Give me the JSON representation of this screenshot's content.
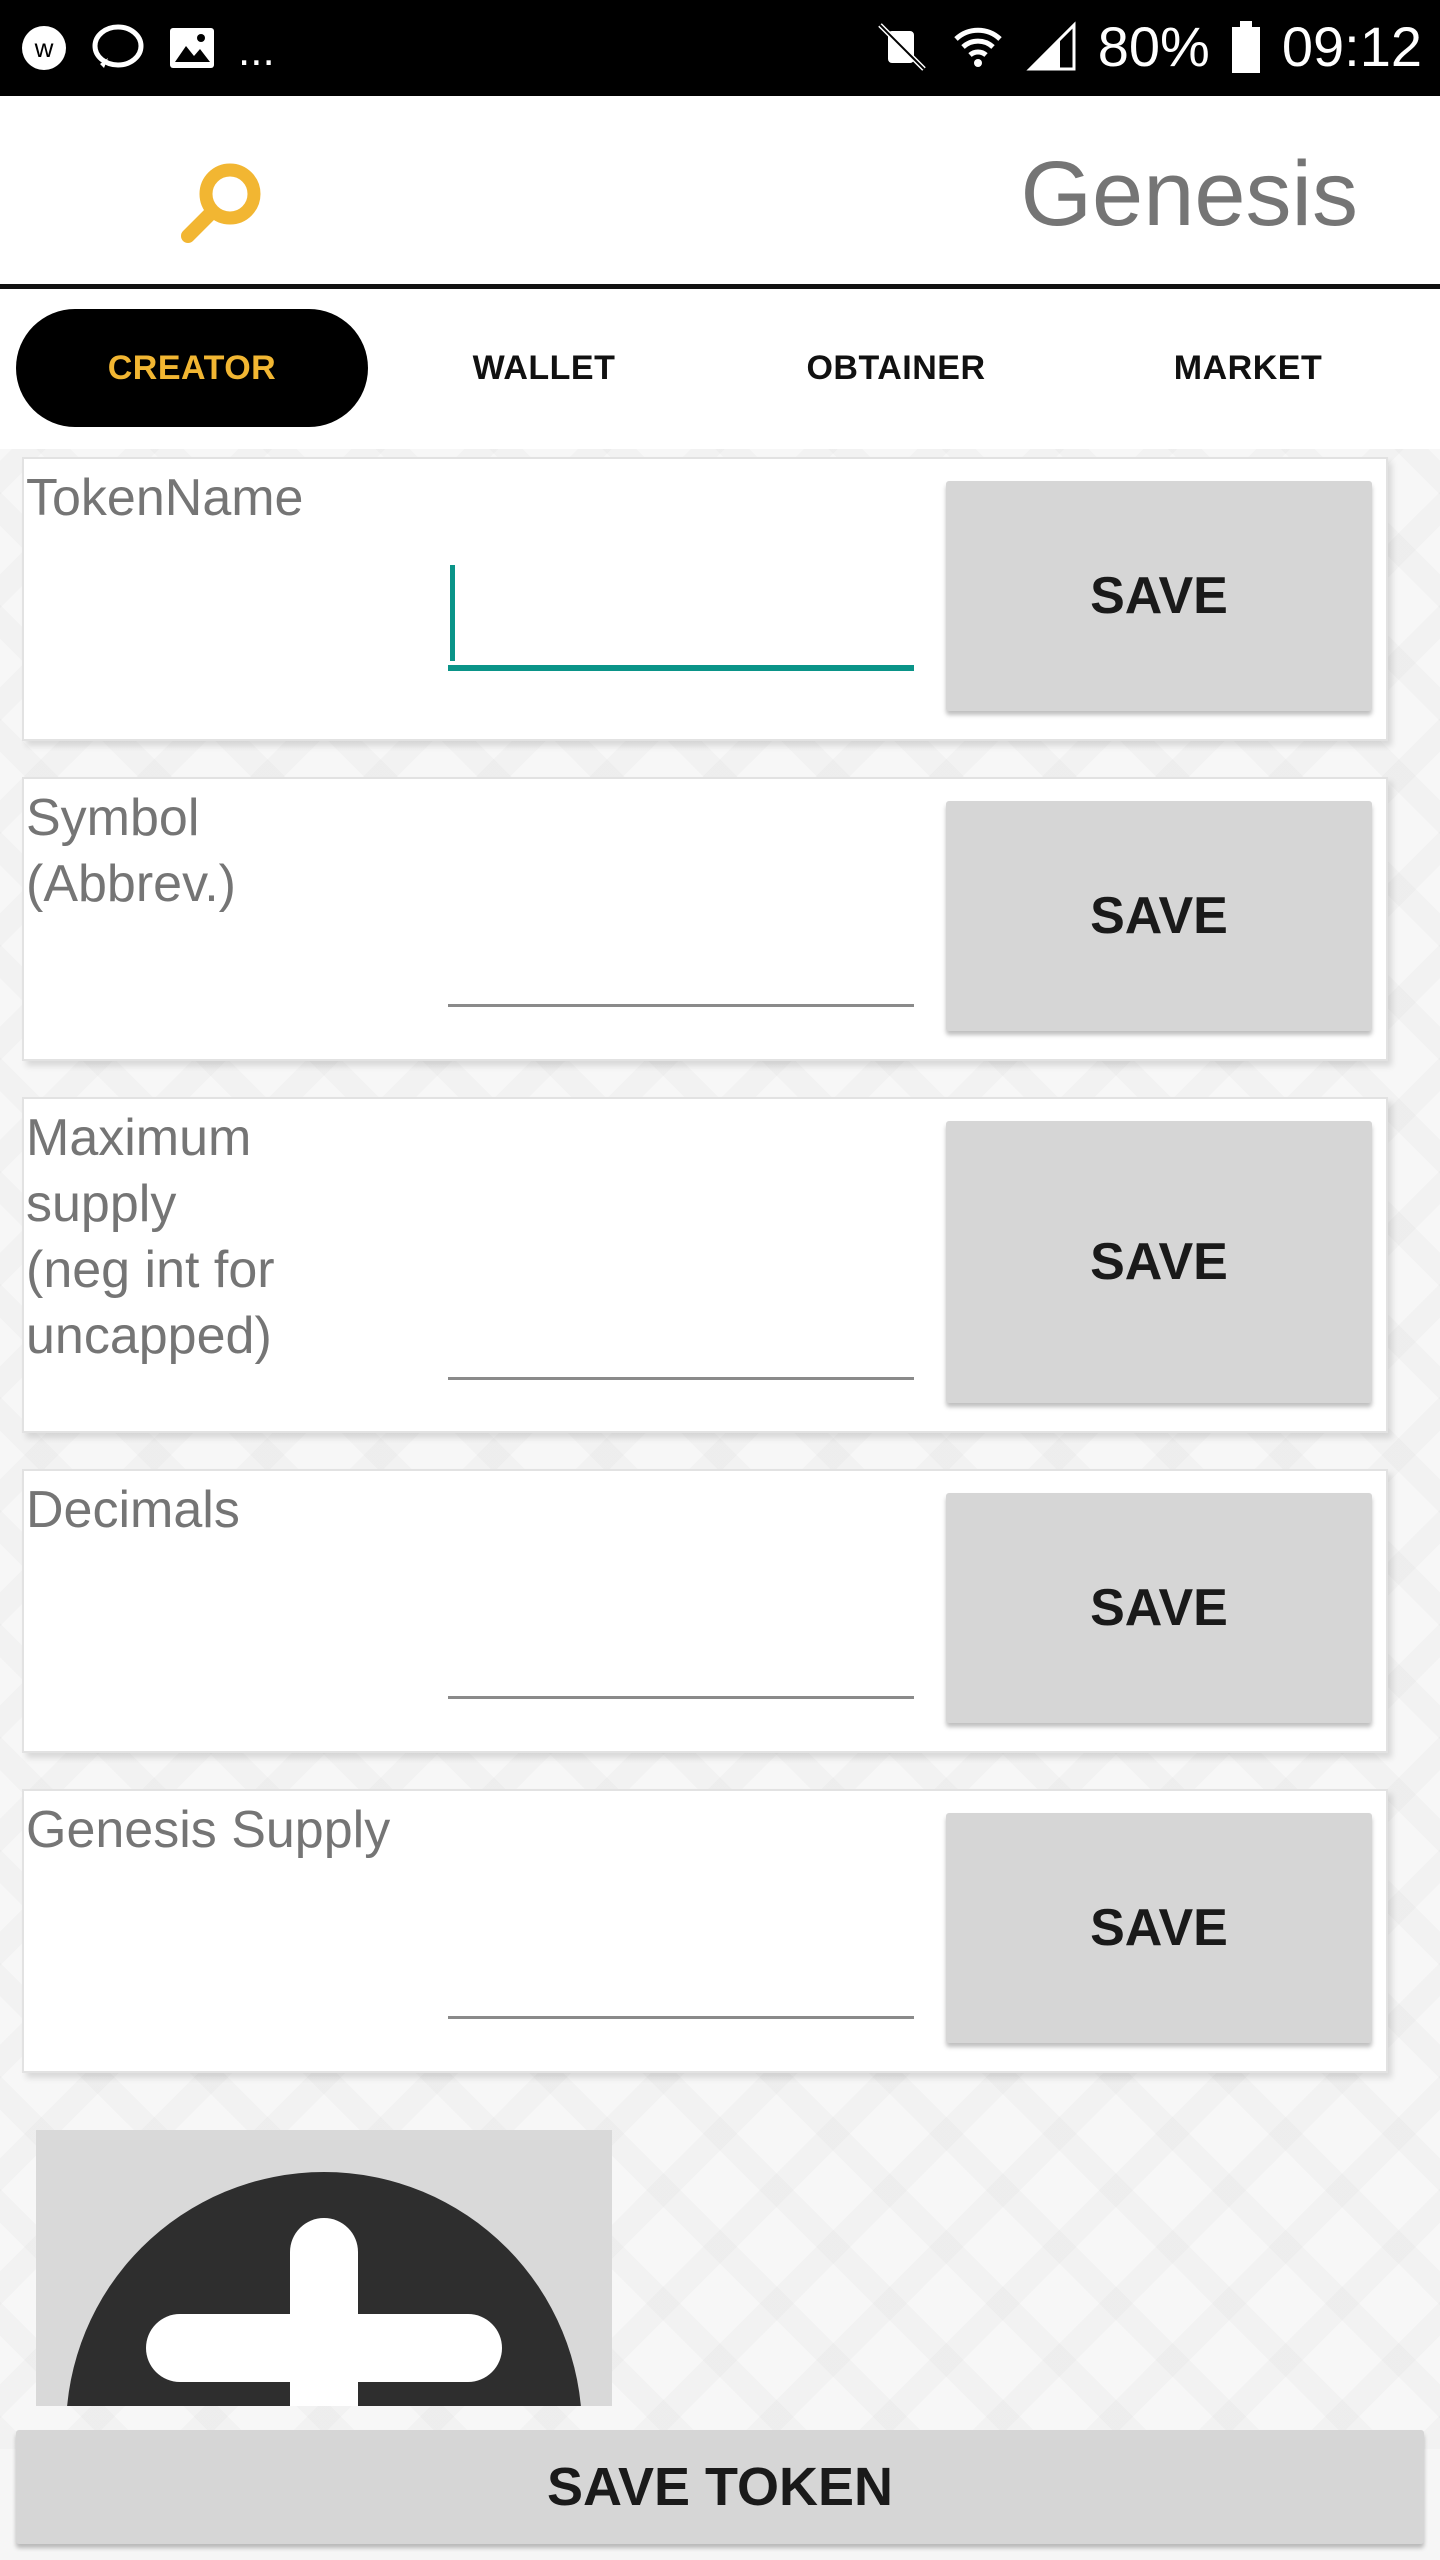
{
  "status_bar": {
    "battery": "80%",
    "time": "09:12",
    "more": "..."
  },
  "header": {
    "title": "Genesis",
    "search_icon": "search-icon",
    "accent_color": "#f2b632"
  },
  "tabs": [
    {
      "label": "CREATOR",
      "active": true
    },
    {
      "label": "WALLET",
      "active": false
    },
    {
      "label": "OBTAINER",
      "active": false
    },
    {
      "label": "MARKET",
      "active": false
    }
  ],
  "form": {
    "fields": [
      {
        "label": "TokenName",
        "value": "",
        "save_label": "SAVE",
        "focused": true
      },
      {
        "label": "Symbol\n (Abbrev.)",
        "value": "",
        "save_label": "SAVE",
        "focused": false
      },
      {
        "label": "Maximum\n supply\n (neg int for\nuncapped)",
        "value": "",
        "save_label": "SAVE",
        "focused": false
      },
      {
        "label": "Decimals",
        "value": "",
        "save_label": "SAVE",
        "focused": false
      },
      {
        "label": "Genesis Supply",
        "value": "",
        "save_label": "SAVE",
        "focused": false
      }
    ]
  },
  "image_picker": {
    "icon": "add-image-icon"
  },
  "save_token_label": "SAVE TOKEN"
}
